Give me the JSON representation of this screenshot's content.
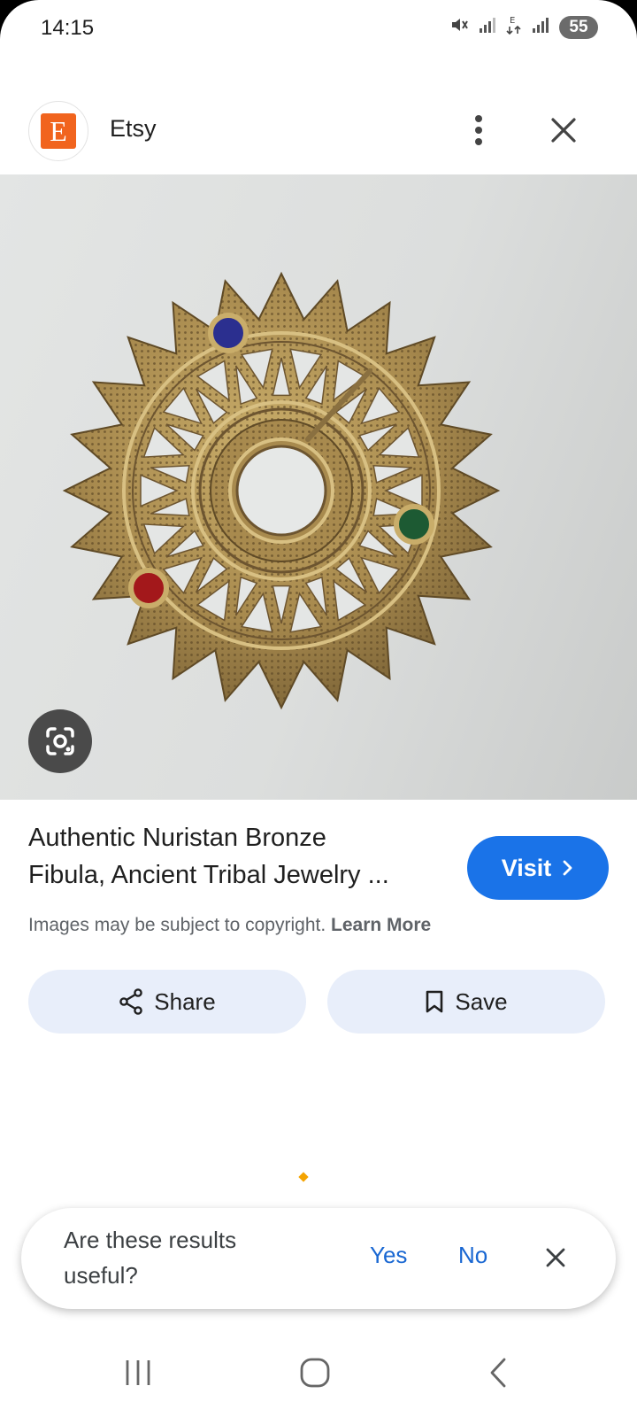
{
  "status_bar": {
    "time": "14:15",
    "battery": "55",
    "icons": [
      "mute-vibrate-icon",
      "signal-icon",
      "data-e-icon",
      "signal-icon"
    ]
  },
  "header": {
    "logo_letter": "E",
    "site_name": "Etsy",
    "logo_color": "#f1641e"
  },
  "result": {
    "title_line1": "Authentic Nuristan Bronze",
    "title_line2": "Fibula, Ancient Tribal Jewelry ...",
    "visit_label": "Visit",
    "copyright_text": "Images may be subject to copyright.",
    "learn_more": "Learn More",
    "accent_color": "#1a73e8"
  },
  "actions": {
    "share_label": "Share",
    "save_label": "Save"
  },
  "feedback": {
    "question": "Are these results useful?",
    "yes": "Yes",
    "no": "No"
  },
  "nav": {
    "buttons": [
      "recents",
      "home",
      "back"
    ]
  }
}
